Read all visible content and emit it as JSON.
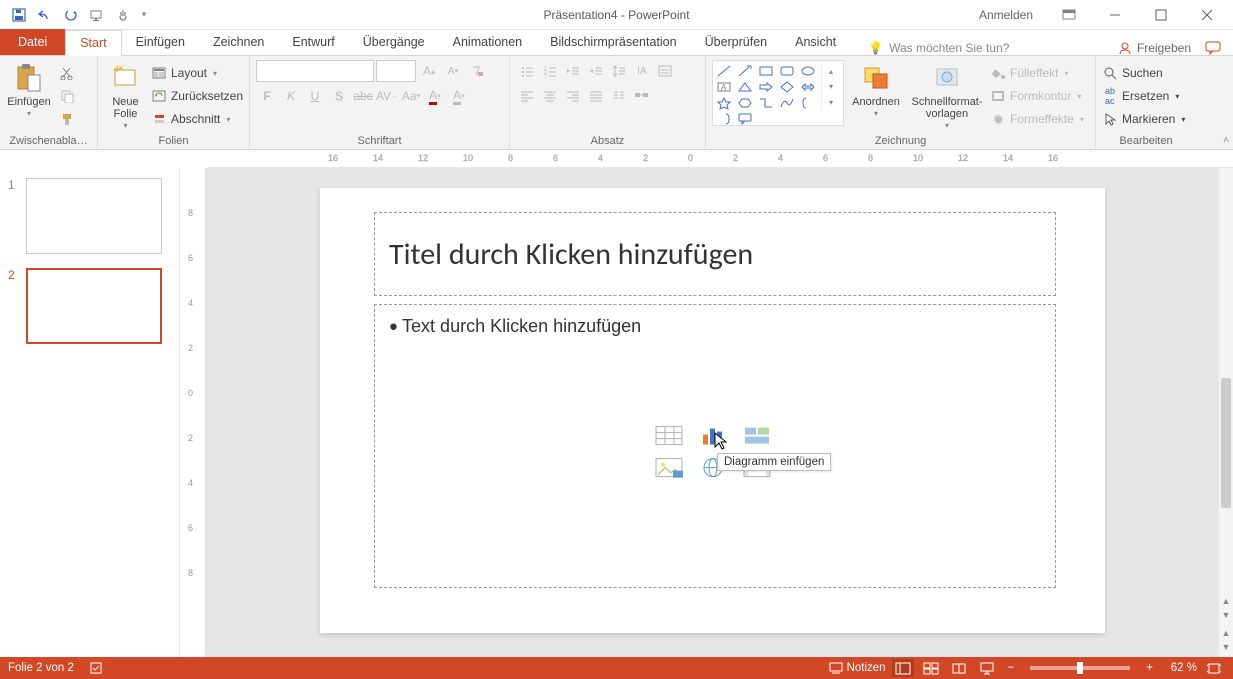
{
  "title": "Präsentation4  -  PowerPoint",
  "login": "Anmelden",
  "tabs": {
    "file": "Datei",
    "home": "Start",
    "insert": "Einfügen",
    "draw": "Zeichnen",
    "design": "Entwurf",
    "transitions": "Übergänge",
    "animations": "Animationen",
    "slideshow": "Bildschirmpräsentation",
    "review": "Überprüfen",
    "view": "Ansicht"
  },
  "tellme": "Was möchten Sie tun?",
  "share": "Freigeben",
  "groups": {
    "clipboard": {
      "label": "Zwischenabla…",
      "paste": "Einfügen"
    },
    "slides": {
      "label": "Folien",
      "newslide": "Neue\nFolie",
      "layout": "Layout",
      "reset": "Zurücksetzen",
      "section": "Abschnitt"
    },
    "font": {
      "label": "Schriftart"
    },
    "paragraph": {
      "label": "Absatz"
    },
    "drawing": {
      "label": "Zeichnung",
      "arrange": "Anordnen",
      "quickstyles": "Schnellformat-\nvorlagen",
      "fill": "Fülleffekt",
      "outline": "Formkontur",
      "effects": "Formeffekte"
    },
    "editing": {
      "label": "Bearbeiten",
      "find": "Suchen",
      "replace": "Ersetzen",
      "select": "Markieren"
    }
  },
  "thumbs": [
    "1",
    "2"
  ],
  "slide": {
    "title_placeholder": "Titel durch Klicken hinzufügen",
    "content_placeholder": "Text durch Klicken hinzufügen",
    "tooltip": "Diagramm einfügen"
  },
  "status": {
    "left": "Folie 2 von 2",
    "notes": "Notizen",
    "zoom": "62 %"
  }
}
